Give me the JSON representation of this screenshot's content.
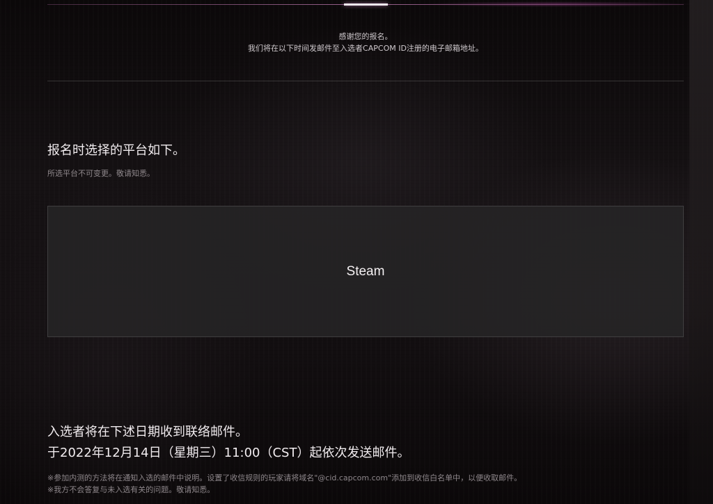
{
  "notice": {
    "line1": "感谢您的报名。",
    "line2": "我们将在以下时间发邮件至入选者CAPCOM ID注册的电子邮箱地址。"
  },
  "platform_section": {
    "title": "报名时选择的平台如下。",
    "note": "所选平台不可变更。敬请知悉。",
    "selected_platform": "Steam"
  },
  "mail_section": {
    "heading_line1": "入选者将在下述日期收到联络邮件。",
    "heading_line2": "于2022年12月14日（星期三）11:00（CST）起依次发送邮件。",
    "footnote1": "※参加内测的方法将在通知入选的邮件中说明。设置了收信规则的玩家请将域名\"@cid.capcom.com\"添加到收信白名单中，以便收取邮件。",
    "footnote2": "※我方不会答复与未入选有关的问题。敬请知悉。"
  },
  "colors": {
    "accent": "#c97ab8",
    "background": "#0a0708",
    "panel": "#262426"
  }
}
